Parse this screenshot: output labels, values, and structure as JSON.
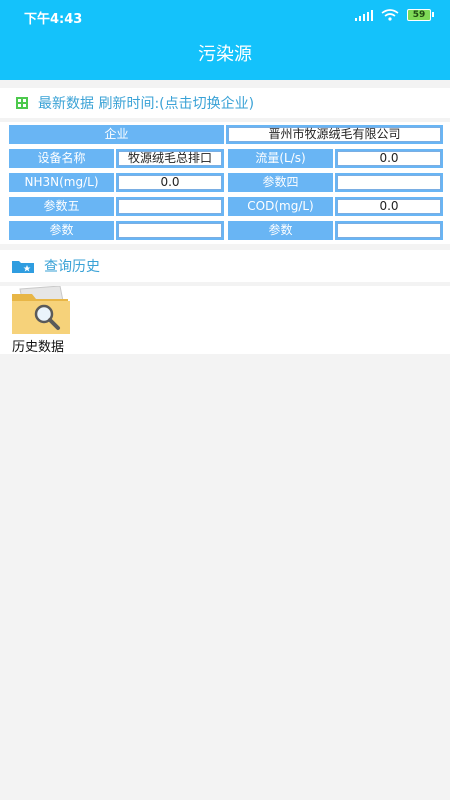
{
  "status": {
    "time": "下午4:43",
    "battery": "59"
  },
  "app": {
    "title": "污染源"
  },
  "latest": {
    "header": "最新数据 刷新时间:(点击切换企业)"
  },
  "table": {
    "enterprise_label": "企业",
    "enterprise_value": "晋州市牧源绒毛有限公司",
    "rows": [
      {
        "l1": "设备名称",
        "v1": "牧源绒毛总排口",
        "l2": "流量(L/s)",
        "v2": "0.0"
      },
      {
        "l1": "NH3N(mg/L)",
        "v1": "0.0",
        "l2": "参数四",
        "v2": ""
      },
      {
        "l1": "参数五",
        "v1": "",
        "l2": "COD(mg/L)",
        "v2": "0.0"
      },
      {
        "l1": "参数",
        "v1": "",
        "l2": "参数",
        "v2": ""
      }
    ]
  },
  "history": {
    "header": "查询历史",
    "item_label": "历史数据"
  }
}
